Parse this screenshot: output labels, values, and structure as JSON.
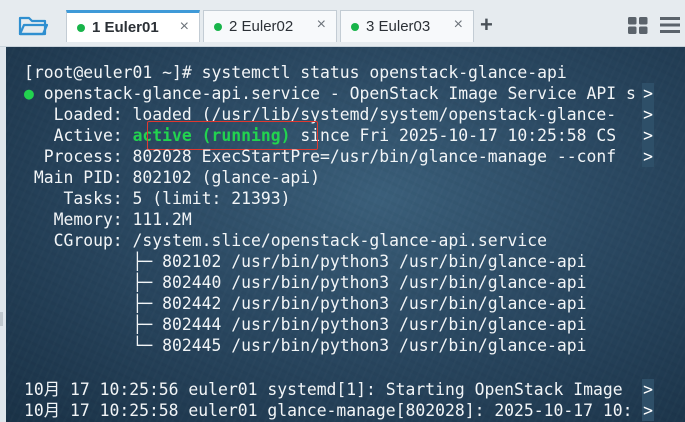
{
  "tabs": [
    {
      "label": "1 Euler01",
      "active": true
    },
    {
      "label": "2 Euler02",
      "active": false
    },
    {
      "label": "3 Euler03",
      "active": false
    }
  ],
  "tab_close_glyph": "×",
  "new_tab_glyph": "+",
  "colors": {
    "accent": "#3f9ad8",
    "status_dot": "#18b44a",
    "running": "#22d34f",
    "highlight_box": "#e0382f"
  },
  "terminal": {
    "prompt_line": "[root@euler01 ~]# systemctl status openstack-glance-api",
    "service_dot": "●",
    "service_line": " openstack-glance-api.service - OpenStack Image Service API s",
    "loaded": "   Loaded: loaded (/usr/lib/systemd/system/openstack-glance-",
    "active_label": "   Active: ",
    "active_state": "active (running)",
    "active_rest": " since Fri 2025-10-17 10:25:58 CS",
    "process": "  Process: 802028 ExecStartPre=/usr/bin/glance-manage --conf",
    "main_pid": " Main PID: 802102 (glance-api)",
    "tasks": "    Tasks: 5 (limit: 21393)",
    "memory": "   Memory: 111.2M",
    "cgroup": "   CGroup: /system.slice/openstack-glance-api.service",
    "children": [
      "           ├─ 802102 /usr/bin/python3 /usr/bin/glance-api",
      "           ├─ 802440 /usr/bin/python3 /usr/bin/glance-api",
      "           ├─ 802442 /usr/bin/python3 /usr/bin/glance-api",
      "           ├─ 802444 /usr/bin/python3 /usr/bin/glance-api",
      "           └─ 802445 /usr/bin/python3 /usr/bin/glance-api"
    ],
    "log1": "10月 17 10:25:56 euler01 systemd[1]: Starting OpenStack Image",
    "log2": "10月 17 10:25:58 euler01 glance-manage[802028]: 2025-10-17 10:",
    "truncation_marker": ">"
  }
}
